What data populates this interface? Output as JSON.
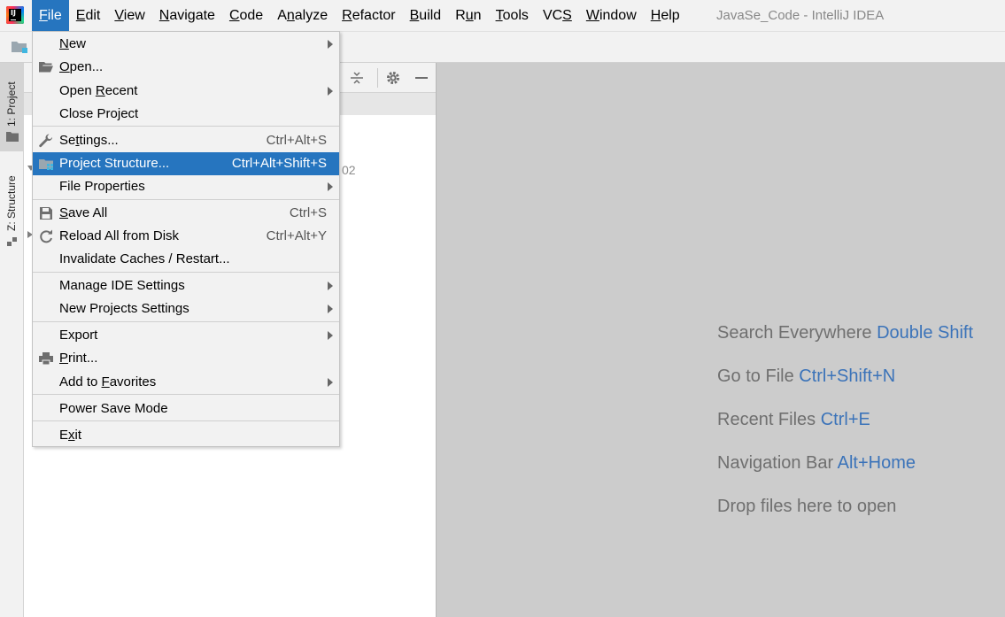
{
  "window": {
    "title": "JavaSe_Code - IntelliJ IDEA"
  },
  "menubar": {
    "items": [
      {
        "label": "File",
        "mnemonic": "F",
        "rest": "ile"
      },
      {
        "label": "Edit",
        "mnemonic": "E",
        "rest": "dit"
      },
      {
        "label": "View",
        "mnemonic": "V",
        "rest": "iew"
      },
      {
        "label": "Navigate",
        "mnemonic": "N",
        "rest": "avigate"
      },
      {
        "label": "Code",
        "mnemonic": "C",
        "rest": "ode"
      },
      {
        "label": "Analyze",
        "pre": "A",
        "mnemonic": "n",
        "rest": "alyze"
      },
      {
        "label": "Refactor",
        "mnemonic": "R",
        "rest": "efactor"
      },
      {
        "label": "Build",
        "mnemonic": "B",
        "rest": "uild"
      },
      {
        "label": "Run",
        "pre": "R",
        "mnemonic": "u",
        "rest": "n"
      },
      {
        "label": "Tools",
        "mnemonic": "T",
        "rest": "ools"
      },
      {
        "label": "VCS",
        "pre": "VC",
        "mnemonic": "S",
        "rest": ""
      },
      {
        "label": "Window",
        "mnemonic": "W",
        "rest": "indow"
      },
      {
        "label": "Help",
        "mnemonic": "H",
        "rest": "elp"
      }
    ]
  },
  "side_tabs": {
    "project": "1: Project",
    "structure": "Z: Structure"
  },
  "project_tree": {
    "partial_text": "02"
  },
  "file_menu": {
    "items": [
      {
        "pre": "",
        "ul": "N",
        "post": "ew",
        "shortcut": "",
        "submenu": true,
        "icon": ""
      },
      {
        "pre": "",
        "ul": "O",
        "post": "pen...",
        "shortcut": "",
        "submenu": false,
        "icon": "folder-open-icon"
      },
      {
        "pre": "Open ",
        "ul": "R",
        "post": "ecent",
        "shortcut": "",
        "submenu": true,
        "icon": ""
      },
      {
        "pre": "Close Project",
        "ul": "",
        "post": "",
        "shortcut": "",
        "submenu": false,
        "icon": ""
      },
      {
        "pre": "Se",
        "ul": "t",
        "post": "tings...",
        "shortcut": "Ctrl+Alt+S",
        "submenu": false,
        "icon": "wrench-icon"
      },
      {
        "pre": "Project Structure...",
        "ul": "",
        "post": "",
        "shortcut": "Ctrl+Alt+Shift+S",
        "submenu": false,
        "icon": "project-structure-icon",
        "selected": true
      },
      {
        "pre": "File Properties",
        "ul": "",
        "post": "",
        "shortcut": "",
        "submenu": true,
        "icon": ""
      },
      {
        "pre": "",
        "ul": "S",
        "post": "ave All",
        "shortcut": "Ctrl+S",
        "submenu": false,
        "icon": "save-icon"
      },
      {
        "pre": "Reload All from Disk",
        "ul": "",
        "post": "",
        "shortcut": "Ctrl+Alt+Y",
        "submenu": false,
        "icon": "reload-icon"
      },
      {
        "pre": "Invalidate Caches / Restart...",
        "ul": "",
        "post": "",
        "shortcut": "",
        "submenu": false,
        "icon": ""
      },
      {
        "pre": "Manage IDE Settings",
        "ul": "",
        "post": "",
        "shortcut": "",
        "submenu": true,
        "icon": ""
      },
      {
        "pre": "New Projects Settings",
        "ul": "",
        "post": "",
        "shortcut": "",
        "submenu": true,
        "icon": ""
      },
      {
        "pre": "Export",
        "ul": "",
        "post": "",
        "shortcut": "",
        "submenu": true,
        "icon": ""
      },
      {
        "pre": "",
        "ul": "P",
        "post": "rint...",
        "shortcut": "",
        "submenu": false,
        "icon": "print-icon"
      },
      {
        "pre": "Add to ",
        "ul": "F",
        "post": "avorites",
        "shortcut": "",
        "submenu": true,
        "icon": ""
      },
      {
        "pre": "Power Save Mode",
        "ul": "",
        "post": "",
        "shortcut": "",
        "submenu": false,
        "icon": ""
      },
      {
        "pre": "E",
        "ul": "x",
        "post": "it",
        "shortcut": "",
        "submenu": false,
        "icon": ""
      }
    ]
  },
  "editor_hints": [
    {
      "text": "Search Everywhere",
      "key": "Double Shift"
    },
    {
      "text": "Go to File",
      "key": "Ctrl+Shift+N"
    },
    {
      "text": "Recent Files",
      "key": "Ctrl+E"
    },
    {
      "text": "Navigation Bar",
      "key": "Alt+Home"
    },
    {
      "text": "Drop files here to open",
      "key": ""
    }
  ],
  "colors": {
    "selection": "#2675bf",
    "hint_key": "#3b73b9",
    "editor_bg": "#cccccc"
  }
}
